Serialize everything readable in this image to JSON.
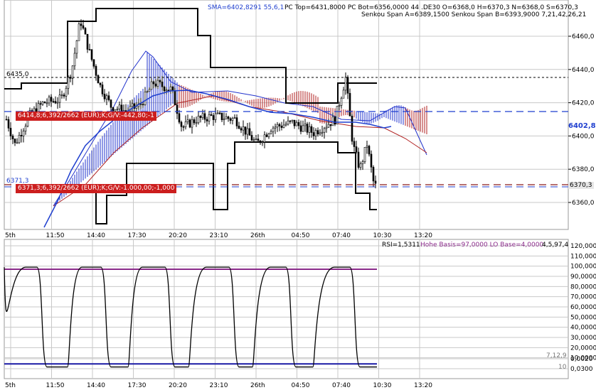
{
  "colors": {
    "grid": "#c8c8c8",
    "price_line": "#000000",
    "sma": "#1f3fcf",
    "kumo_bull": "#2233cc",
    "kumo_bear": "#b02020",
    "order_bg": "#cc1e1e",
    "rsi_line": "#000000",
    "rsi_upper": "#8a2a8a",
    "rsi_lower": "#1a1aa6",
    "dashed_blue": "#1f3fcf",
    "dashed_red": "#8b1a1a"
  },
  "header": {
    "sma": "SMA=6402,8291  55,6,1",
    "pc": "PC Top=6431,8000 PC Bot=6356,0000  44",
    "instrument": ".DE30 O=6368,0 H=6370,3 N=6368,0 S=6370,3",
    "senkou": "Senkou Span A=6389,1500 Senkou Span B=6393,9000  7,21,42,26,21"
  },
  "price_chart": {
    "y_ticks": [
      "6460,0",
      "6440,0",
      "6420,0",
      "6400,0",
      "6380,0",
      "6360,0"
    ],
    "level_left": "6435,0",
    "level_left2": "6371,3",
    "current_price": "6402,8",
    "current_price2": "6370,3",
    "orders": [
      {
        "text": "6414,8;6,392/2662 (EUR);K;G/V:-442,80;-1"
      },
      {
        "text": "6371,3;6,392/2662 (EUR);K;G/V:-1.000,00;-1,000"
      }
    ]
  },
  "time_axis": [
    "5th",
    "11:50",
    "14:40",
    "17:30",
    "20:20",
    "23:10",
    "26th",
    "04:50",
    "07:40",
    "10:30",
    "13:20"
  ],
  "rsi_panel": {
    "header": "RSI=1,5311",
    "header2": "Hohe Basis=97,0000 LO Base=4,0000",
    "header3": "4,5,97,4",
    "y_ticks": [
      "120,0000",
      "110,0000",
      "100,0000",
      "90,0000",
      "80,0000",
      "70,0000",
      "60,0000",
      "50,0000",
      "40,0000",
      "30,0000",
      "20,0000",
      "10,0000",
      "0,0020",
      "0,0300"
    ],
    "label_a": "7,12,9",
    "label_b": "10"
  }
}
